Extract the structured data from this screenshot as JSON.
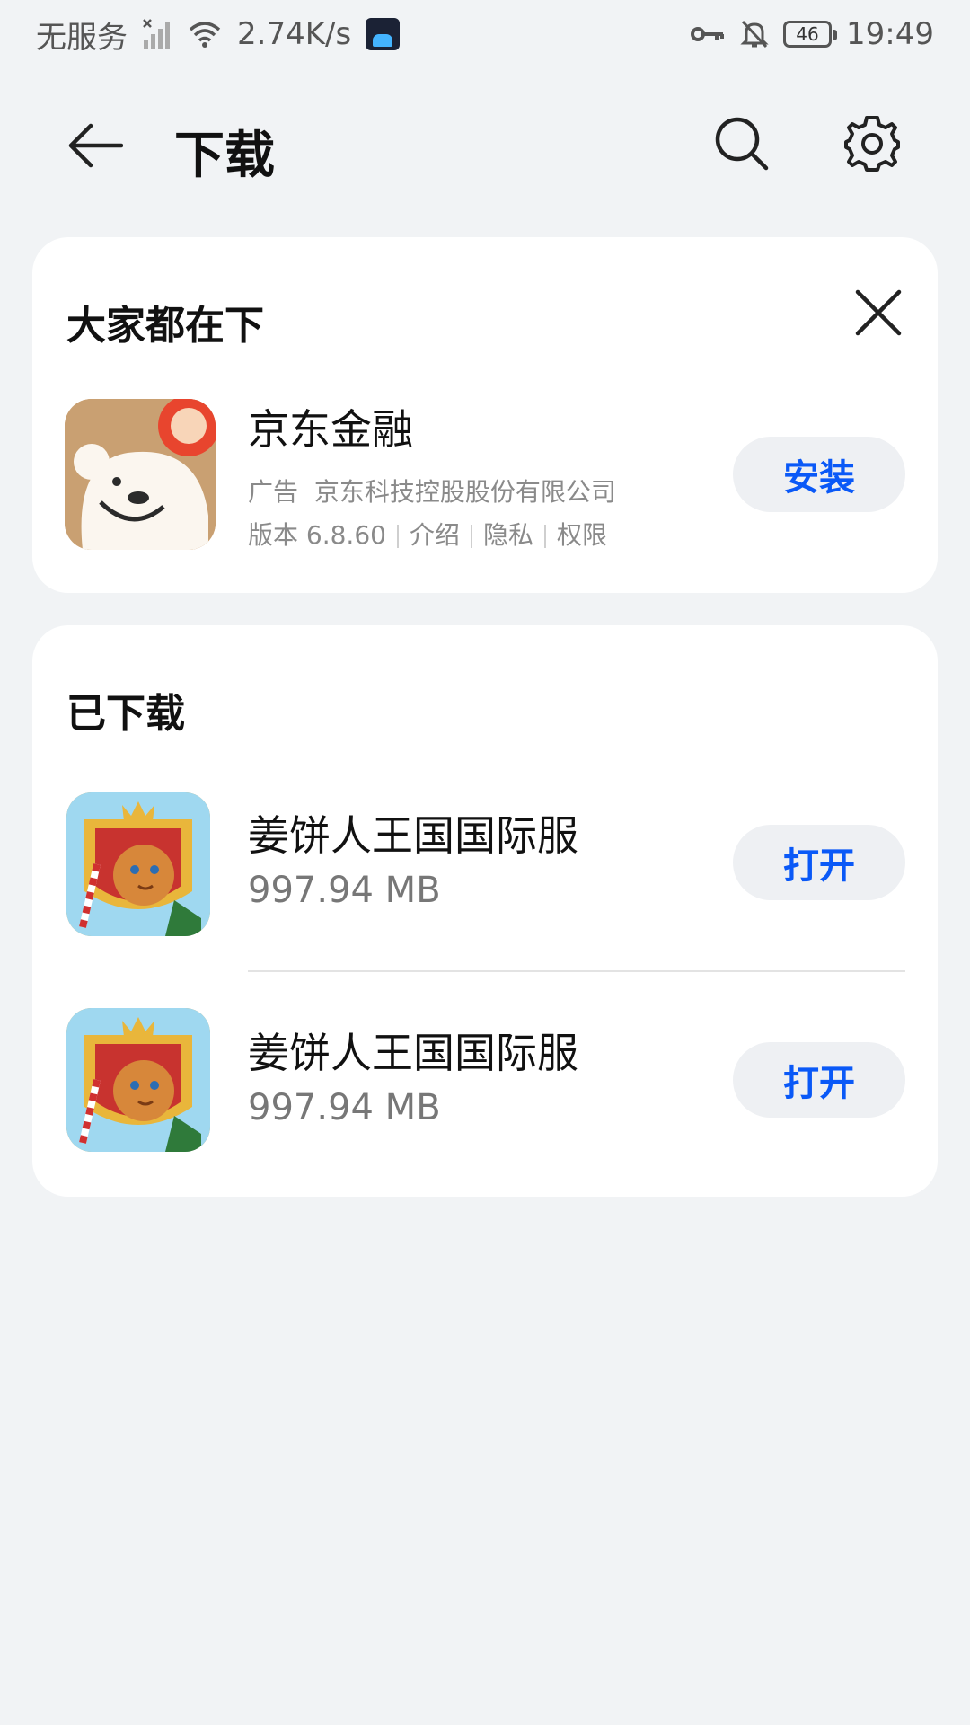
{
  "status_bar": {
    "carrier": "无服务",
    "speed": "2.74K/s",
    "app_badge": "biubiu",
    "battery": "46",
    "time": "19:49"
  },
  "header": {
    "title": "下载"
  },
  "recommend": {
    "title": "大家都在下",
    "app": {
      "name": "京东金融",
      "ad_label": "广告",
      "developer": "京东科技控股股份有限公司",
      "version": "版本 6.8.60",
      "links": [
        "介绍",
        "隐私",
        "权限"
      ],
      "button": "安装"
    }
  },
  "downloaded": {
    "title": "已下载",
    "items": [
      {
        "name": "姜饼人王国国际服",
        "size": "997.94 MB",
        "button": "打开"
      },
      {
        "name": "姜饼人王国国际服",
        "size": "997.94 MB",
        "button": "打开"
      }
    ]
  },
  "colors": {
    "accent": "#0a59f7",
    "background": "#f1f3f5",
    "card": "#ffffff"
  }
}
